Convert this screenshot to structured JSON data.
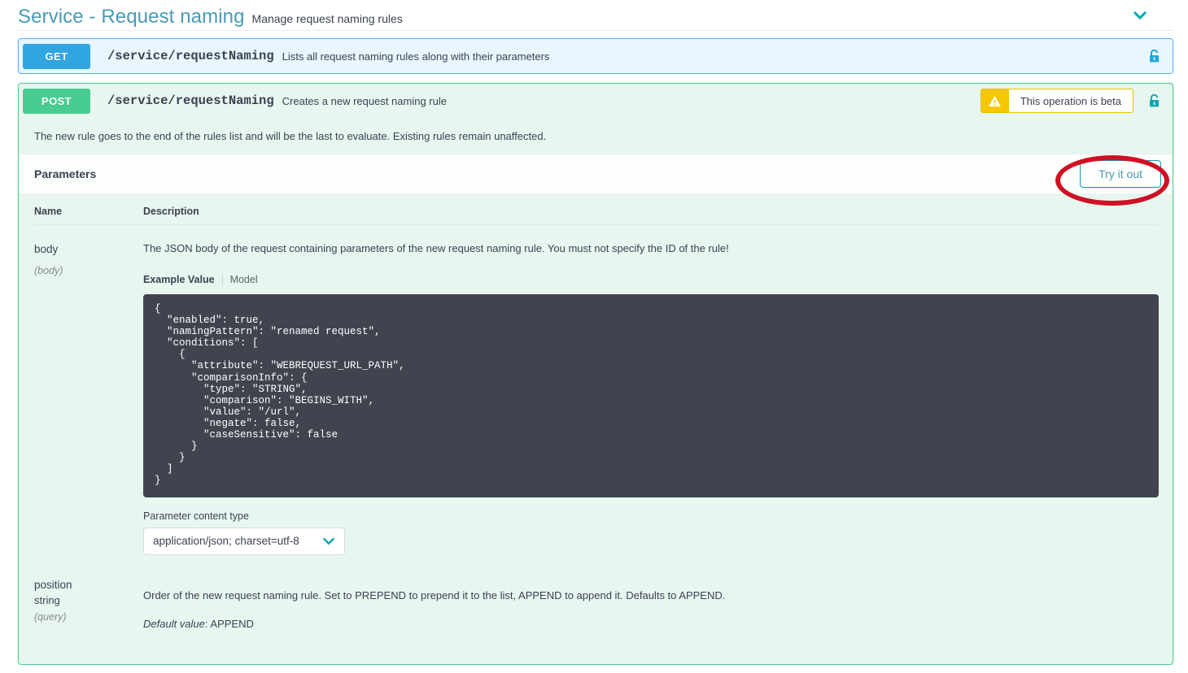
{
  "header": {
    "title": "Service - Request naming",
    "description": "Manage request naming rules",
    "collapse_icon": "chevron-down-icon"
  },
  "colors": {
    "get_method": "#30a5e0",
    "post_method": "#49cc90",
    "get_block_bg": "#e8f6fd",
    "post_block_bg": "#e8f6f0",
    "accent_teal": "#4a9ab5",
    "warning_yellow": "#f4c700",
    "annotation_red": "#cf1124",
    "code_bg": "#41444e"
  },
  "operations": [
    {
      "method": "GET",
      "path": "/service/requestNaming",
      "summary": "Lists all request naming rules along with their parameters",
      "lock_icon": "lock-icon",
      "expanded": false
    },
    {
      "method": "POST",
      "path": "/service/requestNaming",
      "summary": "Creates a new request naming rule",
      "beta_badge": {
        "icon": "warning-triangle-icon",
        "label": "This operation is beta"
      },
      "lock_icon": "lock-icon",
      "expanded": true,
      "note": "The new rule goes to the end of the rules list and will be the last to evaluate. Existing rules remain unaffected.",
      "parameters_section": {
        "title": "Parameters",
        "try_it_out_label": "Try it out",
        "columns": [
          "Name",
          "Description"
        ],
        "rows": [
          {
            "name": "body",
            "type": "",
            "in": "(body)",
            "description": "The JSON body of the request containing parameters of the new request naming rule. You must not specify the ID of the rule!",
            "example_tabs": {
              "active": "Example Value",
              "idle": "Model"
            },
            "example_value": "{\n  \"enabled\": true,\n  \"namingPattern\": \"renamed request\",\n  \"conditions\": [\n    {\n      \"attribute\": \"WEBREQUEST_URL_PATH\",\n      \"comparisonInfo\": {\n        \"type\": \"STRING\",\n        \"comparison\": \"BEGINS_WITH\",\n        \"value\": \"/url\",\n        \"negate\": false,\n        \"caseSensitive\": false\n      }\n    }\n  ]\n}",
            "content_type_label": "Parameter content type",
            "content_type_value": "application/json; charset=utf-8",
            "content_type_icon": "chevron-down-icon"
          },
          {
            "name": "position",
            "type": "string",
            "in": "(query)",
            "description": "Order of the new request naming rule. Set to PREPEND to prepend it to the list, APPEND to append it. Defaults to APPEND.",
            "default_label": "Default value",
            "default_value": "APPEND"
          }
        ]
      }
    }
  ]
}
